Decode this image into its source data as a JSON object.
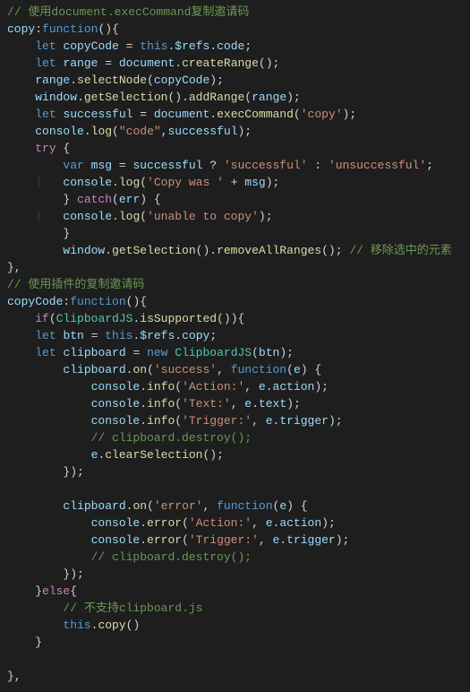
{
  "lines": [
    {
      "indent": "",
      "tokens": [
        {
          "t": "// 使用document.execCommand复制邀请码",
          "c": "c-comment"
        }
      ]
    },
    {
      "indent": "",
      "tokens": [
        {
          "t": "copy",
          "c": "c-key"
        },
        {
          "t": ":",
          "c": "c-punc"
        },
        {
          "t": "function",
          "c": "c-kw"
        },
        {
          "t": "(){",
          "c": "c-punc"
        }
      ]
    },
    {
      "indent": "    ",
      "tokens": [
        {
          "t": "let",
          "c": "c-kw"
        },
        {
          "t": " ",
          "c": ""
        },
        {
          "t": "copyCode",
          "c": "c-var"
        },
        {
          "t": " = ",
          "c": "c-punc"
        },
        {
          "t": "this",
          "c": "c-this"
        },
        {
          "t": ".",
          "c": "c-punc"
        },
        {
          "t": "$refs",
          "c": "c-prop"
        },
        {
          "t": ".",
          "c": "c-punc"
        },
        {
          "t": "code",
          "c": "c-prop"
        },
        {
          "t": ";",
          "c": "c-punc"
        }
      ]
    },
    {
      "indent": "    ",
      "tokens": [
        {
          "t": "let",
          "c": "c-kw"
        },
        {
          "t": " ",
          "c": ""
        },
        {
          "t": "range",
          "c": "c-var"
        },
        {
          "t": " = ",
          "c": "c-punc"
        },
        {
          "t": "document",
          "c": "c-var"
        },
        {
          "t": ".",
          "c": "c-punc"
        },
        {
          "t": "createRange",
          "c": "c-func"
        },
        {
          "t": "();",
          "c": "c-punc"
        }
      ]
    },
    {
      "indent": "    ",
      "tokens": [
        {
          "t": "range",
          "c": "c-var"
        },
        {
          "t": ".",
          "c": "c-punc"
        },
        {
          "t": "selectNode",
          "c": "c-func"
        },
        {
          "t": "(",
          "c": "c-punc"
        },
        {
          "t": "copyCode",
          "c": "c-var"
        },
        {
          "t": ");",
          "c": "c-punc"
        }
      ]
    },
    {
      "indent": "    ",
      "tokens": [
        {
          "t": "window",
          "c": "c-var"
        },
        {
          "t": ".",
          "c": "c-punc"
        },
        {
          "t": "getSelection",
          "c": "c-func"
        },
        {
          "t": "().",
          "c": "c-punc"
        },
        {
          "t": "addRange",
          "c": "c-func"
        },
        {
          "t": "(",
          "c": "c-punc"
        },
        {
          "t": "range",
          "c": "c-var"
        },
        {
          "t": ");",
          "c": "c-punc"
        }
      ]
    },
    {
      "indent": "    ",
      "tokens": [
        {
          "t": "let",
          "c": "c-kw"
        },
        {
          "t": " ",
          "c": ""
        },
        {
          "t": "successful",
          "c": "c-var"
        },
        {
          "t": " = ",
          "c": "c-punc"
        },
        {
          "t": "document",
          "c": "c-var"
        },
        {
          "t": ".",
          "c": "c-punc"
        },
        {
          "t": "execCommand",
          "c": "c-func"
        },
        {
          "t": "(",
          "c": "c-punc"
        },
        {
          "t": "'copy'",
          "c": "c-str"
        },
        {
          "t": ");",
          "c": "c-punc"
        }
      ]
    },
    {
      "indent": "    ",
      "tokens": [
        {
          "t": "console",
          "c": "c-var"
        },
        {
          "t": ".",
          "c": "c-punc"
        },
        {
          "t": "log",
          "c": "c-func"
        },
        {
          "t": "(",
          "c": "c-punc"
        },
        {
          "t": "\"code\"",
          "c": "c-str"
        },
        {
          "t": ",",
          "c": "c-punc"
        },
        {
          "t": "successful",
          "c": "c-var"
        },
        {
          "t": ");",
          "c": "c-punc"
        }
      ]
    },
    {
      "indent": "    ",
      "tokens": [
        {
          "t": "try",
          "c": "c-ctrl"
        },
        {
          "t": " {",
          "c": "c-punc"
        }
      ]
    },
    {
      "indent": "        ",
      "tokens": [
        {
          "t": "var",
          "c": "c-kw"
        },
        {
          "t": " ",
          "c": ""
        },
        {
          "t": "msg",
          "c": "c-var"
        },
        {
          "t": " = ",
          "c": "c-punc"
        },
        {
          "t": "successful",
          "c": "c-var"
        },
        {
          "t": " ? ",
          "c": "c-punc"
        },
        {
          "t": "'successful'",
          "c": "c-str"
        },
        {
          "t": " : ",
          "c": "c-punc"
        },
        {
          "t": "'unsuccessful'",
          "c": "c-str"
        },
        {
          "t": ";",
          "c": "c-punc"
        }
      ]
    },
    {
      "indent": "        ",
      "g": 1,
      "tokens": [
        {
          "t": "console",
          "c": "c-var"
        },
        {
          "t": ".",
          "c": "c-punc"
        },
        {
          "t": "log",
          "c": "c-func"
        },
        {
          "t": "(",
          "c": "c-punc"
        },
        {
          "t": "'Copy was '",
          "c": "c-str"
        },
        {
          "t": " + ",
          "c": "c-punc"
        },
        {
          "t": "msg",
          "c": "c-var"
        },
        {
          "t": ");",
          "c": "c-punc"
        }
      ]
    },
    {
      "indent": "        ",
      "tokens": [
        {
          "t": "} ",
          "c": "c-punc"
        },
        {
          "t": "catch",
          "c": "c-ctrl"
        },
        {
          "t": "(",
          "c": "c-punc"
        },
        {
          "t": "err",
          "c": "c-var"
        },
        {
          "t": ") {",
          "c": "c-punc"
        }
      ]
    },
    {
      "indent": "        ",
      "g": 1,
      "tokens": [
        {
          "t": "console",
          "c": "c-var"
        },
        {
          "t": ".",
          "c": "c-punc"
        },
        {
          "t": "log",
          "c": "c-func"
        },
        {
          "t": "(",
          "c": "c-punc"
        },
        {
          "t": "'unable to copy'",
          "c": "c-str"
        },
        {
          "t": ");",
          "c": "c-punc"
        }
      ]
    },
    {
      "indent": "        ",
      "tokens": [
        {
          "t": "}",
          "c": "c-punc"
        }
      ]
    },
    {
      "indent": "        ",
      "tokens": [
        {
          "t": "window",
          "c": "c-var"
        },
        {
          "t": ".",
          "c": "c-punc"
        },
        {
          "t": "getSelection",
          "c": "c-func"
        },
        {
          "t": "().",
          "c": "c-punc"
        },
        {
          "t": "removeAllRanges",
          "c": "c-func"
        },
        {
          "t": "(); ",
          "c": "c-punc"
        },
        {
          "t": "// 移除选中的元素",
          "c": "c-comment"
        }
      ]
    },
    {
      "indent": "",
      "tokens": [
        {
          "t": "},",
          "c": "c-punc"
        }
      ]
    },
    {
      "indent": "",
      "tokens": [
        {
          "t": "// 使用插件的复制邀请码",
          "c": "c-comment"
        }
      ]
    },
    {
      "indent": "",
      "tokens": [
        {
          "t": "copyCode",
          "c": "c-key"
        },
        {
          "t": ":",
          "c": "c-punc"
        },
        {
          "t": "function",
          "c": "c-kw"
        },
        {
          "t": "(){",
          "c": "c-punc"
        }
      ]
    },
    {
      "indent": "    ",
      "tokens": [
        {
          "t": "if",
          "c": "c-ctrl"
        },
        {
          "t": "(",
          "c": "c-punc"
        },
        {
          "t": "ClipboardJS",
          "c": "c-type"
        },
        {
          "t": ".",
          "c": "c-punc"
        },
        {
          "t": "isSupported",
          "c": "c-func"
        },
        {
          "t": "()){",
          "c": "c-punc"
        }
      ]
    },
    {
      "indent": "    ",
      "tokens": [
        {
          "t": "let",
          "c": "c-kw"
        },
        {
          "t": " ",
          "c": ""
        },
        {
          "t": "btn",
          "c": "c-var"
        },
        {
          "t": " = ",
          "c": "c-punc"
        },
        {
          "t": "this",
          "c": "c-this"
        },
        {
          "t": ".",
          "c": "c-punc"
        },
        {
          "t": "$refs",
          "c": "c-prop"
        },
        {
          "t": ".",
          "c": "c-punc"
        },
        {
          "t": "copy",
          "c": "c-prop"
        },
        {
          "t": ";",
          "c": "c-punc"
        }
      ]
    },
    {
      "indent": "    ",
      "tokens": [
        {
          "t": "let",
          "c": "c-kw"
        },
        {
          "t": " ",
          "c": ""
        },
        {
          "t": "clipboard",
          "c": "c-var"
        },
        {
          "t": " = ",
          "c": "c-punc"
        },
        {
          "t": "new",
          "c": "c-kw"
        },
        {
          "t": " ",
          "c": ""
        },
        {
          "t": "ClipboardJS",
          "c": "c-type"
        },
        {
          "t": "(",
          "c": "c-punc"
        },
        {
          "t": "btn",
          "c": "c-var"
        },
        {
          "t": ");",
          "c": "c-punc"
        }
      ]
    },
    {
      "indent": "        ",
      "tokens": [
        {
          "t": "clipboard",
          "c": "c-var"
        },
        {
          "t": ".",
          "c": "c-punc"
        },
        {
          "t": "on",
          "c": "c-func"
        },
        {
          "t": "(",
          "c": "c-punc"
        },
        {
          "t": "'success'",
          "c": "c-str"
        },
        {
          "t": ", ",
          "c": "c-punc"
        },
        {
          "t": "function",
          "c": "c-kw"
        },
        {
          "t": "(",
          "c": "c-punc"
        },
        {
          "t": "e",
          "c": "c-var"
        },
        {
          "t": ") {",
          "c": "c-punc"
        }
      ]
    },
    {
      "indent": "            ",
      "tokens": [
        {
          "t": "console",
          "c": "c-var"
        },
        {
          "t": ".",
          "c": "c-punc"
        },
        {
          "t": "info",
          "c": "c-func"
        },
        {
          "t": "(",
          "c": "c-punc"
        },
        {
          "t": "'Action:'",
          "c": "c-str"
        },
        {
          "t": ", ",
          "c": "c-punc"
        },
        {
          "t": "e",
          "c": "c-var"
        },
        {
          "t": ".",
          "c": "c-punc"
        },
        {
          "t": "action",
          "c": "c-prop"
        },
        {
          "t": ");",
          "c": "c-punc"
        }
      ]
    },
    {
      "indent": "            ",
      "tokens": [
        {
          "t": "console",
          "c": "c-var"
        },
        {
          "t": ".",
          "c": "c-punc"
        },
        {
          "t": "info",
          "c": "c-func"
        },
        {
          "t": "(",
          "c": "c-punc"
        },
        {
          "t": "'Text:'",
          "c": "c-str"
        },
        {
          "t": ", ",
          "c": "c-punc"
        },
        {
          "t": "e",
          "c": "c-var"
        },
        {
          "t": ".",
          "c": "c-punc"
        },
        {
          "t": "text",
          "c": "c-prop"
        },
        {
          "t": ");",
          "c": "c-punc"
        }
      ]
    },
    {
      "indent": "            ",
      "tokens": [
        {
          "t": "console",
          "c": "c-var"
        },
        {
          "t": ".",
          "c": "c-punc"
        },
        {
          "t": "info",
          "c": "c-func"
        },
        {
          "t": "(",
          "c": "c-punc"
        },
        {
          "t": "'Trigger:'",
          "c": "c-str"
        },
        {
          "t": ", ",
          "c": "c-punc"
        },
        {
          "t": "e",
          "c": "c-var"
        },
        {
          "t": ".",
          "c": "c-punc"
        },
        {
          "t": "trigger",
          "c": "c-prop"
        },
        {
          "t": ");",
          "c": "c-punc"
        }
      ]
    },
    {
      "indent": "            ",
      "tokens": [
        {
          "t": "// clipboard.destroy();",
          "c": "c-comment"
        }
      ]
    },
    {
      "indent": "            ",
      "tokens": [
        {
          "t": "e",
          "c": "c-var"
        },
        {
          "t": ".",
          "c": "c-punc"
        },
        {
          "t": "clearSelection",
          "c": "c-func"
        },
        {
          "t": "();",
          "c": "c-punc"
        }
      ]
    },
    {
      "indent": "        ",
      "tokens": [
        {
          "t": "});",
          "c": "c-punc"
        }
      ]
    },
    {
      "indent": "",
      "tokens": []
    },
    {
      "indent": "        ",
      "tokens": [
        {
          "t": "clipboard",
          "c": "c-var"
        },
        {
          "t": ".",
          "c": "c-punc"
        },
        {
          "t": "on",
          "c": "c-func"
        },
        {
          "t": "(",
          "c": "c-punc"
        },
        {
          "t": "'error'",
          "c": "c-str"
        },
        {
          "t": ", ",
          "c": "c-punc"
        },
        {
          "t": "function",
          "c": "c-kw"
        },
        {
          "t": "(",
          "c": "c-punc"
        },
        {
          "t": "e",
          "c": "c-var"
        },
        {
          "t": ") {",
          "c": "c-punc"
        }
      ]
    },
    {
      "indent": "            ",
      "tokens": [
        {
          "t": "console",
          "c": "c-var"
        },
        {
          "t": ".",
          "c": "c-punc"
        },
        {
          "t": "error",
          "c": "c-func"
        },
        {
          "t": "(",
          "c": "c-punc"
        },
        {
          "t": "'Action:'",
          "c": "c-str"
        },
        {
          "t": ", ",
          "c": "c-punc"
        },
        {
          "t": "e",
          "c": "c-var"
        },
        {
          "t": ".",
          "c": "c-punc"
        },
        {
          "t": "action",
          "c": "c-prop"
        },
        {
          "t": ");",
          "c": "c-punc"
        }
      ]
    },
    {
      "indent": "            ",
      "tokens": [
        {
          "t": "console",
          "c": "c-var"
        },
        {
          "t": ".",
          "c": "c-punc"
        },
        {
          "t": "error",
          "c": "c-func"
        },
        {
          "t": "(",
          "c": "c-punc"
        },
        {
          "t": "'Trigger:'",
          "c": "c-str"
        },
        {
          "t": ", ",
          "c": "c-punc"
        },
        {
          "t": "e",
          "c": "c-var"
        },
        {
          "t": ".",
          "c": "c-punc"
        },
        {
          "t": "trigger",
          "c": "c-prop"
        },
        {
          "t": ");",
          "c": "c-punc"
        }
      ]
    },
    {
      "indent": "            ",
      "tokens": [
        {
          "t": "// clipboard.destroy();",
          "c": "c-comment"
        }
      ]
    },
    {
      "indent": "        ",
      "tokens": [
        {
          "t": "});",
          "c": "c-punc"
        }
      ]
    },
    {
      "indent": "    ",
      "tokens": [
        {
          "t": "}",
          "c": "c-punc"
        },
        {
          "t": "else",
          "c": "c-ctrl"
        },
        {
          "t": "{",
          "c": "c-punc"
        }
      ]
    },
    {
      "indent": "        ",
      "tokens": [
        {
          "t": "// 不支持clipboard.js",
          "c": "c-comment"
        }
      ]
    },
    {
      "indent": "        ",
      "tokens": [
        {
          "t": "this",
          "c": "c-this"
        },
        {
          "t": ".",
          "c": "c-punc"
        },
        {
          "t": "copy",
          "c": "c-func"
        },
        {
          "t": "()",
          "c": "c-punc"
        }
      ]
    },
    {
      "indent": "    ",
      "tokens": [
        {
          "t": "}",
          "c": "c-punc"
        }
      ]
    },
    {
      "indent": "",
      "tokens": []
    },
    {
      "indent": "",
      "tokens": [
        {
          "t": "},",
          "c": "c-punc"
        }
      ]
    }
  ]
}
